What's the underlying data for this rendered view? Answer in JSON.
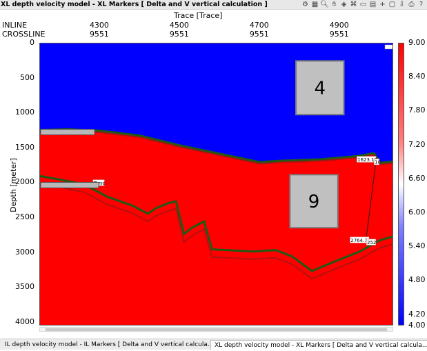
{
  "window": {
    "title": "XL depth velocity model - XL Markers [ Delta and V vertical calculation ]",
    "toolbar_icons": [
      "settings-icon",
      "layout-icon",
      "zoom-icon",
      "pan-icon",
      "layers-icon",
      "filter-icon",
      "dropdown-icon",
      "marker-icon",
      "plot-icon",
      "dropdown-icon",
      "crosshair-icon",
      "comment-icon",
      "export-icon",
      "print-icon",
      "help-icon"
    ]
  },
  "axes": {
    "top_title": "Trace [Trace]",
    "inline_label": "INLINE",
    "crossline_label": "CROSSLINE",
    "left_title": "Depth [meter]"
  },
  "chart_data": {
    "type": "heatmap",
    "x": {
      "inline_ticks": [
        "4300",
        "4500",
        "4700",
        "4900"
      ],
      "crossline_ticks": [
        "9551",
        "9551",
        "9551",
        "9551"
      ],
      "tick_values": [
        4300,
        4500,
        4700,
        4900
      ],
      "range": [
        4150,
        5035
      ]
    },
    "y": {
      "label": "Depth [meter]",
      "ticks": [
        "0",
        "500",
        "1000",
        "1500",
        "2000",
        "2500",
        "3000",
        "3500",
        "4000"
      ],
      "tick_values": [
        0,
        500,
        1000,
        1500,
        2000,
        2500,
        3000,
        3500,
        4000
      ],
      "range": [
        0,
        4050
      ],
      "inverted": true
    },
    "colorbar": {
      "ticks": [
        "9.00",
        "8.40",
        "7.80",
        "7.20",
        "6.60",
        "6.00",
        "5.40",
        "4.80",
        "4.20",
        "4.00"
      ],
      "tick_values": [
        9.0,
        8.4,
        7.8,
        7.2,
        6.6,
        6.0,
        5.4,
        4.8,
        4.2,
        4.0
      ],
      "range": [
        4.0,
        9.0
      ],
      "colors": [
        "#0000ff",
        "#ffffff",
        "#ff0000"
      ]
    },
    "layers": [
      {
        "name": "4",
        "value": 4,
        "color": "#0000ff"
      },
      {
        "name": "9",
        "value": 9,
        "color": "#ff0000"
      }
    ],
    "horizon1": [
      [
        4150,
        1240
      ],
      [
        4220,
        1230
      ],
      [
        4300,
        1250
      ],
      [
        4400,
        1320
      ],
      [
        4500,
        1460
      ],
      [
        4600,
        1580
      ],
      [
        4650,
        1640
      ],
      [
        4700,
        1700
      ],
      [
        4750,
        1680
      ],
      [
        4850,
        1660
      ],
      [
        4950,
        1610
      ],
      [
        4985,
        1570
      ],
      [
        5000,
        1710
      ],
      [
        5035,
        1690
      ]
    ],
    "horizon2": [
      [
        4150,
        1900
      ],
      [
        4200,
        1950
      ],
      [
        4260,
        2020
      ],
      [
        4320,
        2200
      ],
      [
        4380,
        2320
      ],
      [
        4420,
        2440
      ],
      [
        4440,
        2360
      ],
      [
        4470,
        2290
      ],
      [
        4490,
        2260
      ],
      [
        4510,
        2730
      ],
      [
        4530,
        2640
      ],
      [
        4560,
        2550
      ],
      [
        4580,
        2950
      ],
      [
        4620,
        2960
      ],
      [
        4680,
        2980
      ],
      [
        4740,
        2960
      ],
      [
        4780,
        3050
      ],
      [
        4830,
        3260
      ],
      [
        4880,
        3140
      ],
      [
        4950,
        2980
      ],
      [
        5000,
        2820
      ],
      [
        5035,
        2760
      ]
    ],
    "labels": [
      "1623.12",
      "2764.72",
      "Time"
    ],
    "label_suffix": [
      "10",
      "252"
    ]
  },
  "layer_boxes": {
    "top": "4",
    "bottom": "9"
  },
  "tabs": [
    {
      "label": "IL depth velocity model - IL Markers [ Delta and V vertical calcula..."
    },
    {
      "label": "XL depth velocity model - XL Markers [ Delta and V vertical calcula..."
    }
  ],
  "tab_close": "x"
}
